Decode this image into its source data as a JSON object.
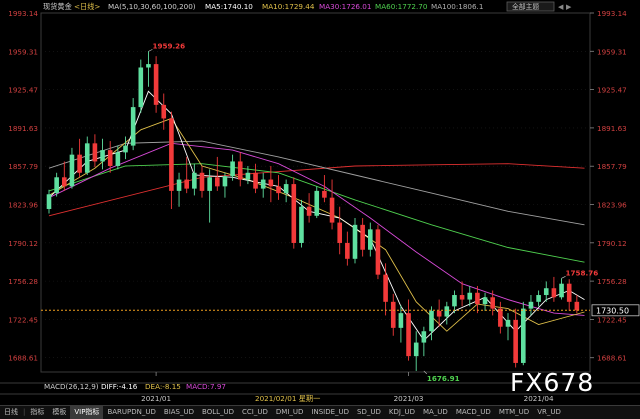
{
  "header": {
    "title": "现货黄金",
    "period": "<日线>",
    "ma_label": "MA(5,10,30,60,100,200)",
    "indicators": [
      {
        "label": "MA5:1740.10",
        "color": "#ffffff"
      },
      {
        "label": "MA10:1729.44",
        "color": "#e0c04a"
      },
      {
        "label": "MA30:1726.01",
        "color": "#d84ad8"
      },
      {
        "label": "MA60:1772.70",
        "color": "#4fd04f"
      },
      {
        "label": "MA100:1806.1",
        "color": "#b0b0b0"
      }
    ],
    "layout_button": "全部主题"
  },
  "macd": {
    "label": "MACD(26,12,9)",
    "diff": "DIFF:-4.16",
    "dea": "DEA:-8.15",
    "macd": "MACD:7.97"
  },
  "cursor_date": "2021/02/01 星期一",
  "watermark": "FX678",
  "toolbar": {
    "items": [
      "指标",
      "模板",
      "VIP指标",
      "BARUPDN_UD",
      "BIAS_UD",
      "BOLL_UD",
      "CCI_UD",
      "DMI_UD",
      "INSIDE_UD",
      "SD_UD",
      "KDJ_UD",
      "MA_UD",
      "MACD_UD",
      "MTM_UD",
      "VR_UD"
    ],
    "active_index": 2,
    "first_label": "日线"
  },
  "colors": {
    "up": "#5fe0a0",
    "down": "#f23a3a",
    "ma5": "#ffffff",
    "ma10": "#e0c04a",
    "ma30": "#d84ad8",
    "ma60": "#4fd04f",
    "ma100": "#a0a0a0",
    "ma200": "#e03030",
    "current": "#f0a020"
  },
  "chart_data": {
    "type": "candlestick",
    "ylim": [
      1676.0,
      1993.14
    ],
    "y_ticks": [
      1993.14,
      1959.31,
      1925.47,
      1891.63,
      1857.79,
      1823.96,
      1790.12,
      1756.28,
      1722.45,
      1688.61
    ],
    "x_ticks": [
      {
        "label": "2021/01",
        "index": 14
      },
      {
        "label": "2021/03",
        "index": 47
      },
      {
        "label": "2021/04",
        "index": 64
      }
    ],
    "annotations": [
      {
        "label": "1959.26",
        "index": 13,
        "value": 1959.26
      },
      {
        "label": "1676.91",
        "index": 49,
        "value": 1676.91
      },
      {
        "label": "1758.76",
        "index": 67,
        "value": 1758.76
      }
    ],
    "current_price": 1730.5,
    "candles": [
      {
        "o": 1820,
        "h": 1837,
        "c": 1833,
        "l": 1816
      },
      {
        "o": 1834,
        "h": 1852,
        "c": 1848,
        "l": 1831
      },
      {
        "o": 1848,
        "h": 1862,
        "c": 1840,
        "l": 1836
      },
      {
        "o": 1840,
        "h": 1874,
        "c": 1868,
        "l": 1838
      },
      {
        "o": 1868,
        "h": 1882,
        "c": 1852,
        "l": 1848
      },
      {
        "o": 1852,
        "h": 1884,
        "c": 1878,
        "l": 1850
      },
      {
        "o": 1878,
        "h": 1886,
        "c": 1862,
        "l": 1857
      },
      {
        "o": 1862,
        "h": 1882,
        "c": 1872,
        "l": 1855
      },
      {
        "o": 1872,
        "h": 1880,
        "c": 1858,
        "l": 1852
      },
      {
        "o": 1858,
        "h": 1876,
        "c": 1870,
        "l": 1855
      },
      {
        "o": 1870,
        "h": 1884,
        "c": 1876,
        "l": 1864
      },
      {
        "o": 1876,
        "h": 1918,
        "c": 1910,
        "l": 1872
      },
      {
        "o": 1910,
        "h": 1952,
        "c": 1945,
        "l": 1905
      },
      {
        "o": 1945,
        "h": 1959.26,
        "c": 1948,
        "l": 1928
      },
      {
        "o": 1948,
        "h": 1955,
        "c": 1912,
        "l": 1905
      },
      {
        "o": 1912,
        "h": 1922,
        "c": 1900,
        "l": 1890
      },
      {
        "o": 1900,
        "h": 1906,
        "c": 1836,
        "l": 1820
      },
      {
        "o": 1836,
        "h": 1852,
        "c": 1846,
        "l": 1822
      },
      {
        "o": 1846,
        "h": 1866,
        "c": 1838,
        "l": 1834
      },
      {
        "o": 1838,
        "h": 1860,
        "c": 1852,
        "l": 1832
      },
      {
        "o": 1852,
        "h": 1858,
        "c": 1836,
        "l": 1830
      },
      {
        "o": 1836,
        "h": 1855,
        "c": 1848,
        "l": 1808
      },
      {
        "o": 1848,
        "h": 1866,
        "c": 1840,
        "l": 1836
      },
      {
        "o": 1840,
        "h": 1852,
        "c": 1849,
        "l": 1830
      },
      {
        "o": 1849,
        "h": 1868,
        "c": 1862,
        "l": 1845
      },
      {
        "o": 1862,
        "h": 1870,
        "c": 1846,
        "l": 1840
      },
      {
        "o": 1846,
        "h": 1858,
        "c": 1852,
        "l": 1842
      },
      {
        "o": 1852,
        "h": 1860,
        "c": 1838,
        "l": 1834
      },
      {
        "o": 1838,
        "h": 1852,
        "c": 1846,
        "l": 1830
      },
      {
        "o": 1846,
        "h": 1858,
        "c": 1840,
        "l": 1826
      },
      {
        "o": 1840,
        "h": 1850,
        "c": 1834,
        "l": 1828
      },
      {
        "o": 1834,
        "h": 1846,
        "c": 1842,
        "l": 1826
      },
      {
        "o": 1842,
        "h": 1848,
        "c": 1790,
        "l": 1785
      },
      {
        "o": 1790,
        "h": 1828,
        "c": 1822,
        "l": 1786
      },
      {
        "o": 1822,
        "h": 1834,
        "c": 1814,
        "l": 1808
      },
      {
        "o": 1814,
        "h": 1840,
        "c": 1836,
        "l": 1812
      },
      {
        "o": 1836,
        "h": 1850,
        "c": 1830,
        "l": 1826
      },
      {
        "o": 1830,
        "h": 1846,
        "c": 1808,
        "l": 1802
      },
      {
        "o": 1808,
        "h": 1822,
        "c": 1790,
        "l": 1780
      },
      {
        "o": 1790,
        "h": 1800,
        "c": 1776,
        "l": 1770
      },
      {
        "o": 1776,
        "h": 1812,
        "c": 1806,
        "l": 1772
      },
      {
        "o": 1806,
        "h": 1812,
        "c": 1784,
        "l": 1778
      },
      {
        "o": 1784,
        "h": 1808,
        "c": 1802,
        "l": 1778
      },
      {
        "o": 1802,
        "h": 1806,
        "c": 1762,
        "l": 1758
      },
      {
        "o": 1762,
        "h": 1772,
        "c": 1738,
        "l": 1726
      },
      {
        "o": 1738,
        "h": 1745,
        "c": 1715,
        "l": 1708
      },
      {
        "o": 1715,
        "h": 1735,
        "c": 1728,
        "l": 1702
      },
      {
        "o": 1728,
        "h": 1740,
        "c": 1690,
        "l": 1686
      },
      {
        "o": 1690,
        "h": 1712,
        "c": 1702,
        "l": 1676.91
      },
      {
        "o": 1702,
        "h": 1716,
        "c": 1712,
        "l": 1690
      },
      {
        "o": 1712,
        "h": 1734,
        "c": 1730,
        "l": 1704
      },
      {
        "o": 1730,
        "h": 1740,
        "c": 1725,
        "l": 1716
      },
      {
        "o": 1725,
        "h": 1738,
        "c": 1734,
        "l": 1718
      },
      {
        "o": 1734,
        "h": 1748,
        "c": 1744,
        "l": 1728
      },
      {
        "o": 1744,
        "h": 1756,
        "c": 1740,
        "l": 1734
      },
      {
        "o": 1740,
        "h": 1752,
        "c": 1746,
        "l": 1734
      },
      {
        "o": 1746,
        "h": 1752,
        "c": 1736,
        "l": 1728
      },
      {
        "o": 1736,
        "h": 1746,
        "c": 1742,
        "l": 1730
      },
      {
        "o": 1742,
        "h": 1748,
        "c": 1732,
        "l": 1726
      },
      {
        "o": 1732,
        "h": 1738,
        "c": 1716,
        "l": 1710
      },
      {
        "o": 1716,
        "h": 1728,
        "c": 1722,
        "l": 1704
      },
      {
        "o": 1722,
        "h": 1732,
        "c": 1684,
        "l": 1680
      },
      {
        "o": 1684,
        "h": 1738,
        "c": 1732,
        "l": 1682
      },
      {
        "o": 1732,
        "h": 1744,
        "c": 1738,
        "l": 1726
      },
      {
        "o": 1738,
        "h": 1748,
        "c": 1744,
        "l": 1734
      },
      {
        "o": 1744,
        "h": 1756,
        "c": 1750,
        "l": 1738
      },
      {
        "o": 1750,
        "h": 1760,
        "c": 1742,
        "l": 1738
      },
      {
        "o": 1742,
        "h": 1758.76,
        "c": 1754,
        "l": 1740
      },
      {
        "o": 1754,
        "h": 1758,
        "c": 1738,
        "l": 1730
      },
      {
        "o": 1738,
        "h": 1744,
        "c": 1730.5,
        "l": 1728
      }
    ],
    "ma200": [
      {
        "i": 0,
        "v": 1814
      },
      {
        "i": 20,
        "v": 1848
      },
      {
        "i": 40,
        "v": 1858
      },
      {
        "i": 60,
        "v": 1860
      },
      {
        "i": 70,
        "v": 1856
      }
    ],
    "ma100": [
      {
        "i": 0,
        "v": 1856
      },
      {
        "i": 10,
        "v": 1878
      },
      {
        "i": 20,
        "v": 1880
      },
      {
        "i": 30,
        "v": 1866
      },
      {
        "i": 40,
        "v": 1850
      },
      {
        "i": 50,
        "v": 1834
      },
      {
        "i": 60,
        "v": 1818
      },
      {
        "i": 70,
        "v": 1806
      }
    ],
    "ma60": [
      {
        "i": 0,
        "v": 1836
      },
      {
        "i": 10,
        "v": 1858
      },
      {
        "i": 20,
        "v": 1860
      },
      {
        "i": 30,
        "v": 1852
      },
      {
        "i": 40,
        "v": 1828
      },
      {
        "i": 50,
        "v": 1806
      },
      {
        "i": 60,
        "v": 1786
      },
      {
        "i": 70,
        "v": 1773
      }
    ],
    "ma30": [
      {
        "i": 0,
        "v": 1830
      },
      {
        "i": 8,
        "v": 1856
      },
      {
        "i": 16,
        "v": 1878
      },
      {
        "i": 24,
        "v": 1872
      },
      {
        "i": 30,
        "v": 1860
      },
      {
        "i": 36,
        "v": 1840
      },
      {
        "i": 42,
        "v": 1812
      },
      {
        "i": 48,
        "v": 1782
      },
      {
        "i": 54,
        "v": 1754
      },
      {
        "i": 60,
        "v": 1740
      },
      {
        "i": 66,
        "v": 1728
      },
      {
        "i": 70,
        "v": 1726
      }
    ],
    "ma10": [
      {
        "i": 0,
        "v": 1832
      },
      {
        "i": 6,
        "v": 1856
      },
      {
        "i": 12,
        "v": 1890
      },
      {
        "i": 16,
        "v": 1900
      },
      {
        "i": 20,
        "v": 1858
      },
      {
        "i": 26,
        "v": 1846
      },
      {
        "i": 32,
        "v": 1830
      },
      {
        "i": 38,
        "v": 1812
      },
      {
        "i": 44,
        "v": 1784
      },
      {
        "i": 48,
        "v": 1738
      },
      {
        "i": 52,
        "v": 1712
      },
      {
        "i": 56,
        "v": 1736
      },
      {
        "i": 60,
        "v": 1732
      },
      {
        "i": 64,
        "v": 1718
      },
      {
        "i": 70,
        "v": 1729
      }
    ],
    "ma5": [
      {
        "i": 0,
        "v": 1830
      },
      {
        "i": 5,
        "v": 1862
      },
      {
        "i": 10,
        "v": 1872
      },
      {
        "i": 13,
        "v": 1924
      },
      {
        "i": 16,
        "v": 1904
      },
      {
        "i": 19,
        "v": 1850
      },
      {
        "i": 24,
        "v": 1848
      },
      {
        "i": 30,
        "v": 1840
      },
      {
        "i": 34,
        "v": 1818
      },
      {
        "i": 38,
        "v": 1812
      },
      {
        "i": 42,
        "v": 1794
      },
      {
        "i": 46,
        "v": 1734
      },
      {
        "i": 49,
        "v": 1704
      },
      {
        "i": 53,
        "v": 1730
      },
      {
        "i": 57,
        "v": 1742
      },
      {
        "i": 61,
        "v": 1712
      },
      {
        "i": 65,
        "v": 1740
      },
      {
        "i": 68,
        "v": 1748
      },
      {
        "i": 70,
        "v": 1740
      }
    ]
  }
}
